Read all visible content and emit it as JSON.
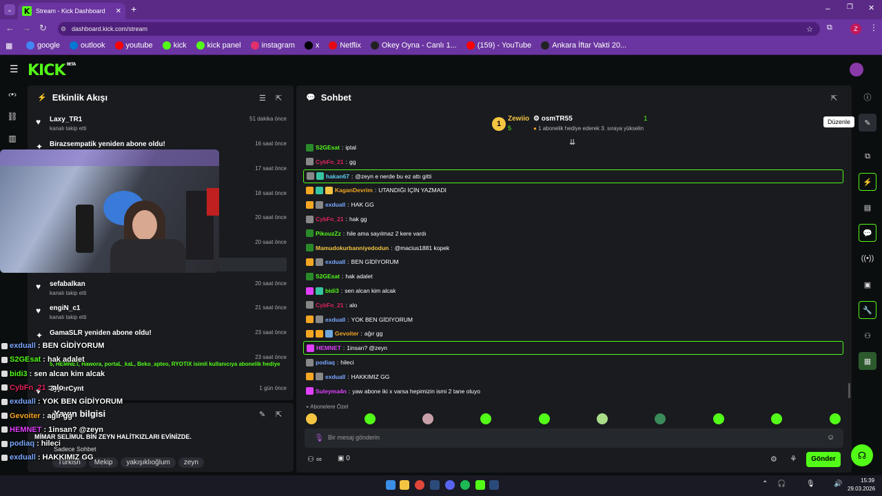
{
  "browser": {
    "tab_title": "Stream - Kick Dashboard",
    "url": "dashboard.kick.com/stream",
    "profile_initial": "Z",
    "bookmarks": [
      {
        "label": "google",
        "color": "#4285f4"
      },
      {
        "label": "outlook",
        "color": "#0078d4"
      },
      {
        "label": "youtube",
        "color": "#ff0000"
      },
      {
        "label": "kick",
        "color": "#53fc18"
      },
      {
        "label": "kick panel",
        "color": "#53fc18"
      },
      {
        "label": "instagram",
        "color": "#e1306c"
      },
      {
        "label": "x",
        "color": "#000000"
      },
      {
        "label": "Netflix",
        "color": "#e50914"
      },
      {
        "label": "Okey Oyna - Canlı 1...",
        "color": "#222222"
      },
      {
        "label": "(159) - YouTube",
        "color": "#ff0000"
      },
      {
        "label": "Ankara İftar Vakti 20...",
        "color": "#222222"
      }
    ]
  },
  "kick": {
    "logo": "KICK",
    "beta": "BETA"
  },
  "activity": {
    "title": "Etkinlik Akışı",
    "items": [
      {
        "name": "Laxy_TR1",
        "sub": "kanalı takip etti",
        "time": "51 dakika önce",
        "icon": "heart"
      },
      {
        "name": "Birazsempatik yeniden abone oldu!",
        "sub": "",
        "time": "16 saat önce",
        "icon": "star"
      },
      {
        "name": "",
        "sub": "",
        "time": "17 saat önce",
        "icon": ""
      },
      {
        "name": "",
        "sub": "",
        "time": "18 saat önce",
        "icon": ""
      },
      {
        "name": "",
        "sub": "",
        "time": "20 saat önce",
        "icon": ""
      },
      {
        "name": "",
        "sub": "",
        "time": "20 saat önce",
        "icon": ""
      },
      {
        "name": "sefabalkan",
        "sub": "kanalı takip etti",
        "time": "20 saat önce",
        "icon": "heart"
      },
      {
        "name": "engiN_c1",
        "sub": "kanalı takip etti",
        "time": "21 saat önce",
        "icon": "heart"
      },
      {
        "name": "GamaSLR yeniden abone oldu!",
        "sub": "",
        "time": "23 saat önce",
        "icon": "star"
      },
      {
        "name": "",
        "sub": "5, HEMNET, Hawora, portaL_kaL, Beko_apteo, RYOTIX isimli kullanıcıya abonelik hediye",
        "time": "23 saat önce",
        "icon": ""
      },
      {
        "name": "ZyperCynt",
        "sub": "",
        "time": "1 gün önce",
        "icon": "heart"
      }
    ]
  },
  "stream_info": {
    "title": "Yayın bilgisi",
    "stream_title": "MİMAR SELİMUL BİN ZEYN HALİTKIZLARI EVİNİZDE.",
    "chat_mode": "Sadece Sohbet",
    "tags": [
      "Türkish",
      "Mekip",
      "yakışıklıoğlum",
      "zeyn"
    ]
  },
  "chat": {
    "title": "Sohbet",
    "leader": {
      "rank": "1",
      "name": "Zewiio",
      "count": "5",
      "second": "osmTR55",
      "second_count": "1",
      "note": "1 abonelik hediye ederek 3. sıraya yükselin"
    },
    "messages": [
      {
        "nick": "S2GEsat",
        "color": "#53fc18",
        "text": "iptal",
        "hl": false,
        "badges": [
          "#2a8a2a"
        ]
      },
      {
        "nick": "CybFn_21",
        "color": "#e0245e",
        "text": "gg",
        "hl": false,
        "badges": [
          "#888888"
        ]
      },
      {
        "nick": "hakan67",
        "color": "#5ad1f0",
        "text": "@zeyn e nerde bu ez attı gitti",
        "hl": true,
        "badges": [
          "#888888",
          "#36c5a0"
        ]
      },
      {
        "nick": "KaganDevrim",
        "color": "#f5a623",
        "text": "UTANDIĞI İÇİN YAZMADI",
        "hl": false,
        "badges": [
          "#f5a623",
          "#36c5a0",
          "#f5c542"
        ]
      },
      {
        "nick": "exduall",
        "color": "#7aa8ff",
        "text": "HAK GG",
        "hl": false,
        "badges": [
          "#f5a623",
          "#888888"
        ]
      },
      {
        "nick": "CybFn_21",
        "color": "#e0245e",
        "text": "hak gg",
        "hl": false,
        "badges": [
          "#888888"
        ]
      },
      {
        "nick": "PikouzZz",
        "color": "#53fc18",
        "text": "hile ama sayılmaz 2 kere vardı",
        "hl": false,
        "badges": [
          "#2a8a2a"
        ]
      },
      {
        "nick": "Mamudokurbanniyedodun",
        "color": "#f5c542",
        "text": "@macius1881 kopek",
        "hl": false,
        "badges": [
          "#2a8a2a"
        ]
      },
      {
        "nick": "exduall",
        "color": "#7aa8ff",
        "text": "BEN GİDİYORUM",
        "hl": false,
        "badges": [
          "#f5a623",
          "#888888"
        ]
      },
      {
        "nick": "S2GEsat",
        "color": "#53fc18",
        "text": "hak adalet",
        "hl": false,
        "badges": [
          "#2a8a2a"
        ]
      },
      {
        "nick": "bidi3",
        "color": "#53fc18",
        "text": "sen alcan kim alcak",
        "hl": false,
        "badges": [
          "#e040fb",
          "#36c5a0"
        ]
      },
      {
        "nick": "CybFn_21",
        "color": "#e0245e",
        "text": "alo",
        "hl": false,
        "badges": [
          "#888888"
        ]
      },
      {
        "nick": "exduall",
        "color": "#7aa8ff",
        "text": "YOK BEN GİDİYORUM",
        "hl": false,
        "badges": [
          "#f5a623",
          "#888888"
        ]
      },
      {
        "nick": "Gevoiter",
        "color": "#f5a623",
        "text": "ağır gg",
        "hl": false,
        "badges": [
          "#f5a623",
          "#f5a623",
          "#6fa8dc"
        ]
      },
      {
        "nick": "HEMNET",
        "color": "#e040fb",
        "text": "1insan? @zeyn",
        "hl": true,
        "badges": [
          "#e040fb"
        ]
      },
      {
        "nick": "podiaq",
        "color": "#7aa8ff",
        "text": "hileci",
        "hl": false,
        "badges": [
          "#888888"
        ]
      },
      {
        "nick": "exduall",
        "color": "#7aa8ff",
        "text": "HAKKIMIZ GG",
        "hl": false,
        "badges": [
          "#f5a623",
          "#888888"
        ]
      },
      {
        "nick": "Suleyma4n",
        "color": "#e040fb",
        "text": "yaw abone iki x varsa hepimizin ismi 2 tane oluyo",
        "hl": false,
        "badges": [
          "#e040fb"
        ]
      }
    ],
    "sub_only_label": "Abonelere Özel",
    "input_placeholder": "Bir mesaj gönderin",
    "infinity": "∞",
    "viewer_count": "0",
    "send_label": "Gönder"
  },
  "overlay_chat": [
    {
      "nick": "exduall",
      "color": "#7aa8ff",
      "text": ": BEN GİDİYORUM"
    },
    {
      "nick": "S2GEsat",
      "color": "#53fc18",
      "text": ": hak adalet"
    },
    {
      "nick": "bidi3",
      "color": "#53fc18",
      "text": ": sen alcan kim alcak"
    },
    {
      "nick": "CybFn_21",
      "color": "#e0245e",
      "text": ": alo"
    },
    {
      "nick": "exduall",
      "color": "#7aa8ff",
      "text": ": YOK BEN GİDİYORUM"
    },
    {
      "nick": "Gevoiter",
      "color": "#f5a623",
      "text": ": ağır gg"
    },
    {
      "nick": "HEMNET",
      "color": "#e040fb",
      "text": ": 1insan? @zeyn"
    },
    {
      "nick": "podiaq",
      "color": "#7aa8ff",
      "text": ": hileci"
    },
    {
      "nick": "exduall",
      "color": "#7aa8ff",
      "text": ": HAKKIMIZ GG"
    }
  ],
  "tooltip": "Düzenle",
  "taskbar": {
    "time": "15:39",
    "date": "29.03.2026"
  }
}
